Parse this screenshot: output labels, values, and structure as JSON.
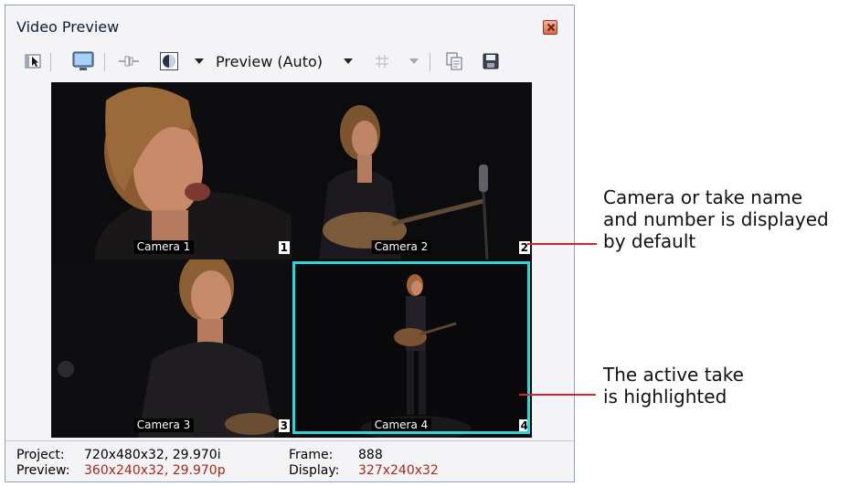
{
  "window": {
    "title": "Video Preview"
  },
  "toolbar": {
    "preview_quality": "Preview (Auto)"
  },
  "takes": [
    {
      "label": "Camera 1",
      "number": "1"
    },
    {
      "label": "Camera 2",
      "number": "2"
    },
    {
      "label": "Camera 3",
      "number": "3"
    },
    {
      "label": "Camera 4",
      "number": "4"
    }
  ],
  "active_take": "Camera 4",
  "status": {
    "project_label": "Project:",
    "project_value": "720x480x32, 29.970i",
    "preview_label": "Preview:",
    "preview_value": "360x240x32, 29.970p",
    "frame_label": "Frame:",
    "frame_value": "888",
    "display_label": "Display:",
    "display_value": "327x240x32"
  },
  "annotations": {
    "name_line1": "Camera or take name",
    "name_line2": "and number is displayed",
    "name_line3": "by default",
    "active_line1": "The active take",
    "active_line2": "is highlighted"
  },
  "colors": {
    "highlight": "#2fd6d9",
    "leader": "#d8232a",
    "status_red": "#a5271d"
  }
}
